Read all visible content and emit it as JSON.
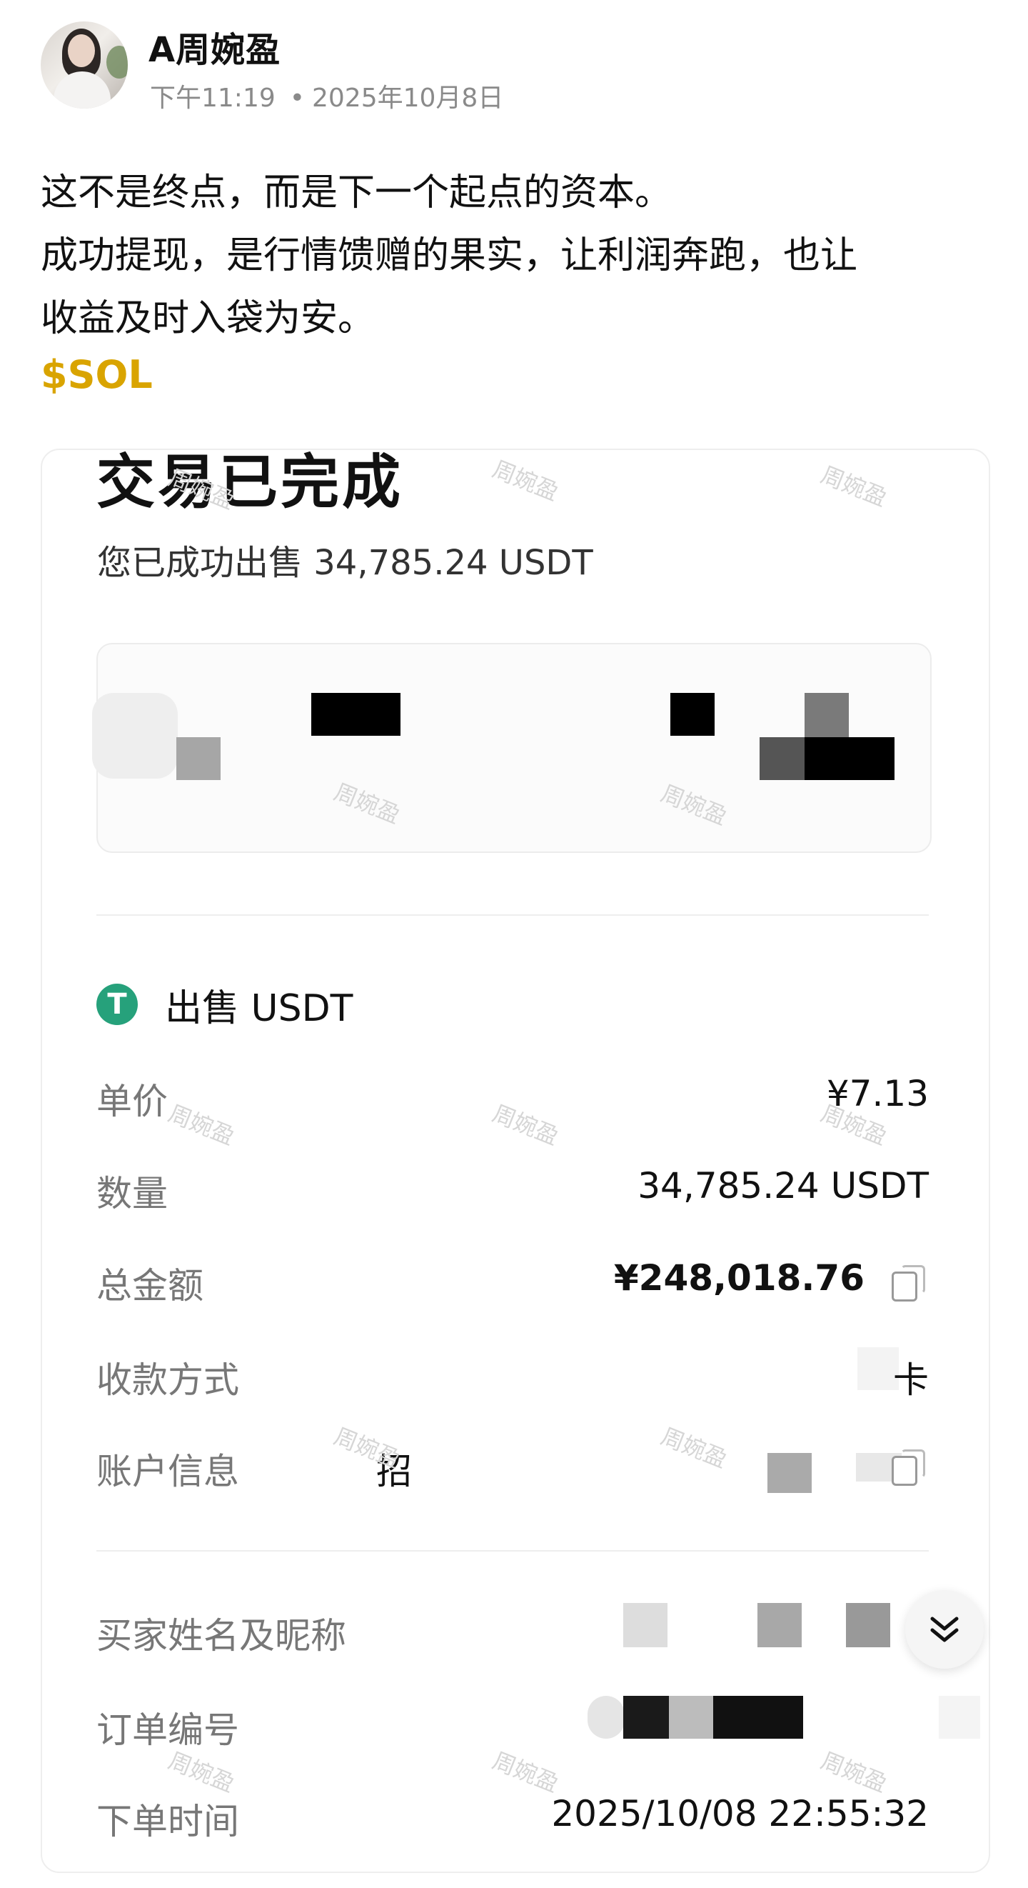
{
  "post": {
    "author": "A周婉盈",
    "time": "下午11:19",
    "date": "2025年10月8日",
    "lines": [
      "这不是终点，而是下一个起点的资本。",
      "成功提现，是行情馈赠的果实，让利润奔跑，也让",
      "收益及时入袋为安。"
    ],
    "tag": "$SOL",
    "tag_color": "#d9a400"
  },
  "screenshot": {
    "title": "交易已完成",
    "subtitle": "您已成功出售 34,785.24 USDT",
    "asset_icon": "tether-icon",
    "asset_icon_glyph": "T",
    "asset_label": "出售 USDT",
    "rows": [
      {
        "label": "单价",
        "value": "¥7.13"
      },
      {
        "label": "数量",
        "value": "34,785.24 USDT"
      },
      {
        "label": "总金额",
        "value": "¥248,018.76"
      },
      {
        "label": "收款方式",
        "value": "卡"
      },
      {
        "label": "账户信息",
        "value": "招"
      },
      {
        "label": "买家姓名及昵称",
        "value": ""
      },
      {
        "label": "订单编号",
        "value": ""
      },
      {
        "label": "下单时间",
        "value": "2025/10/08 22:55:32"
      }
    ],
    "watermark": "周婉盈",
    "accent_color": "#26a17b"
  }
}
